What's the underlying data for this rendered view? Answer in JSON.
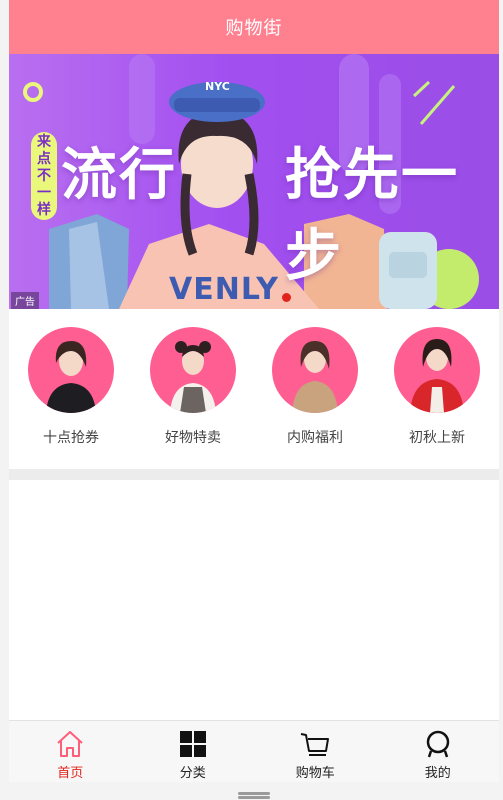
{
  "navbar": {
    "title": "购物街"
  },
  "banner": {
    "slogan_left": "流行",
    "slogan_right": "抢先一步",
    "tagline": [
      "来",
      "点",
      "不",
      "一",
      "样"
    ],
    "ad_label": "广告",
    "cap_text": "NYC",
    "shirt_text": "VENLY"
  },
  "shortcuts": [
    {
      "label": "十点抢券"
    },
    {
      "label": "好物特卖"
    },
    {
      "label": "内购福利"
    },
    {
      "label": "初秋上新"
    }
  ],
  "tabs": [
    {
      "label": "首页",
      "icon": "home-icon",
      "active": true
    },
    {
      "label": "分类",
      "icon": "category-grid-icon",
      "active": false
    },
    {
      "label": "购物车",
      "icon": "cart-icon",
      "active": false
    },
    {
      "label": "我的",
      "icon": "profile-icon",
      "active": false
    }
  ],
  "colors": {
    "navbar": "#ff8190",
    "accent": "#e2231a",
    "avatar_bg": "#ff5e92"
  }
}
